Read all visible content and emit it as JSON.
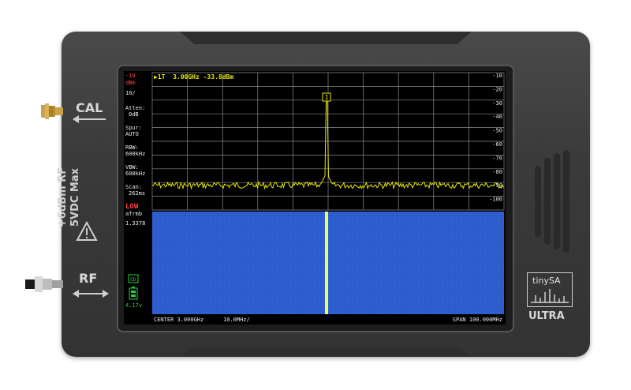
{
  "device": {
    "cal_label": "CAL",
    "rf_label": "RF",
    "side_line1": "+6dBm RF",
    "side_line2": "5VDC Max",
    "brand": "tinySA",
    "model": "ULTRA"
  },
  "marker": {
    "header": "▶1T  3.00GHz -33.8dBm",
    "tag": "1"
  },
  "left_panel": {
    "ref_level": "-10",
    "ref_unit": "dBm",
    "scale": "10/",
    "atten_label": "Atten:",
    "atten_value": "0dB",
    "spur_label": "Spur:",
    "spur_value": "AUTO",
    "rbw_label": "RBW:",
    "rbw_value": "600kHz",
    "vbw_label": "VBW:",
    "vbw_value": "600kHz",
    "scan_label": "Scan:",
    "scan_value": "262ms",
    "mode": "LOW",
    "afrmb": "afrmb",
    "version": "1.3378",
    "sd_badge": "SD",
    "battery_voltage": "4.17v"
  },
  "right_axis": [
    "-10",
    "-20",
    "-30",
    "-40",
    "-50",
    "-60",
    "-70",
    "-80",
    "-90",
    "-100"
  ],
  "bottom_bar": {
    "center": "CENTER 3.000GHz",
    "per_div": "10.0MHz/",
    "span": "SPAN 100.000MHz"
  },
  "colors": {
    "trace": "#e6e600",
    "waterfall": "#2f5fd0",
    "grid": "#8a8a8a",
    "text_red": "#ff4040",
    "text_white": "#e8e8e8"
  }
}
